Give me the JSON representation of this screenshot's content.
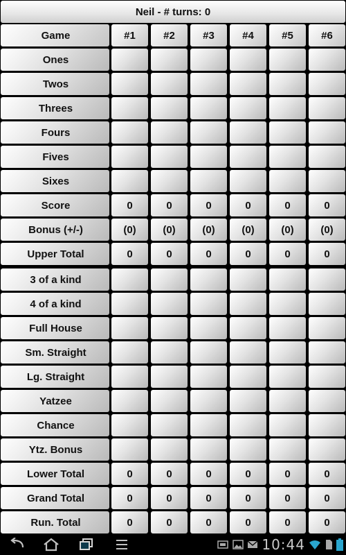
{
  "title": "Neil - # turns: 0",
  "header": {
    "game_label": "Game",
    "columns": [
      "#1",
      "#2",
      "#3",
      "#4",
      "#5",
      "#6"
    ]
  },
  "rows": [
    {
      "label": "Ones",
      "values": [
        "",
        "",
        "",
        "",
        "",
        ""
      ]
    },
    {
      "label": "Twos",
      "values": [
        "",
        "",
        "",
        "",
        "",
        ""
      ]
    },
    {
      "label": "Threes",
      "values": [
        "",
        "",
        "",
        "",
        "",
        ""
      ]
    },
    {
      "label": "Fours",
      "values": [
        "",
        "",
        "",
        "",
        "",
        ""
      ]
    },
    {
      "label": "Fives",
      "values": [
        "",
        "",
        "",
        "",
        "",
        ""
      ]
    },
    {
      "label": "Sixes",
      "values": [
        "",
        "",
        "",
        "",
        "",
        ""
      ]
    },
    {
      "label": "Score",
      "values": [
        "0",
        "0",
        "0",
        "0",
        "0",
        "0"
      ]
    },
    {
      "label": "Bonus (+/-)",
      "values": [
        "(0)",
        "(0)",
        "(0)",
        "(0)",
        "(0)",
        "(0)"
      ]
    },
    {
      "label": "Upper Total",
      "values": [
        "0",
        "0",
        "0",
        "0",
        "0",
        "0"
      ]
    },
    {
      "label": "3 of a kind",
      "values": [
        "",
        "",
        "",
        "",
        "",
        ""
      ]
    },
    {
      "label": "4 of a kind",
      "values": [
        "",
        "",
        "",
        "",
        "",
        ""
      ]
    },
    {
      "label": "Full House",
      "values": [
        "",
        "",
        "",
        "",
        "",
        ""
      ]
    },
    {
      "label": "Sm. Straight",
      "values": [
        "",
        "",
        "",
        "",
        "",
        ""
      ]
    },
    {
      "label": "Lg. Straight",
      "values": [
        "",
        "",
        "",
        "",
        "",
        ""
      ]
    },
    {
      "label": "Yatzee",
      "values": [
        "",
        "",
        "",
        "",
        "",
        ""
      ]
    },
    {
      "label": "Chance",
      "values": [
        "",
        "",
        "",
        "",
        "",
        ""
      ]
    },
    {
      "label": "Ytz. Bonus",
      "values": [
        "",
        "",
        "",
        "",
        "",
        ""
      ]
    },
    {
      "label": "Lower Total",
      "values": [
        "0",
        "0",
        "0",
        "0",
        "0",
        "0"
      ]
    },
    {
      "label": "Grand Total",
      "values": [
        "0",
        "0",
        "0",
        "0",
        "0",
        "0"
      ]
    },
    {
      "label": "Run. Total",
      "values": [
        "0",
        "0",
        "0",
        "0",
        "0",
        "0"
      ]
    }
  ],
  "status_bar": {
    "time": "10:44",
    "icons": [
      "usb-icon",
      "image-icon",
      "mail-icon",
      "wifi-icon",
      "sd-card-icon",
      "battery-icon"
    ]
  },
  "nav_bar": {
    "buttons": [
      "back-icon",
      "home-icon",
      "recent-apps-icon",
      "menu-icon"
    ],
    "accent_color": "#1f6f8f"
  }
}
